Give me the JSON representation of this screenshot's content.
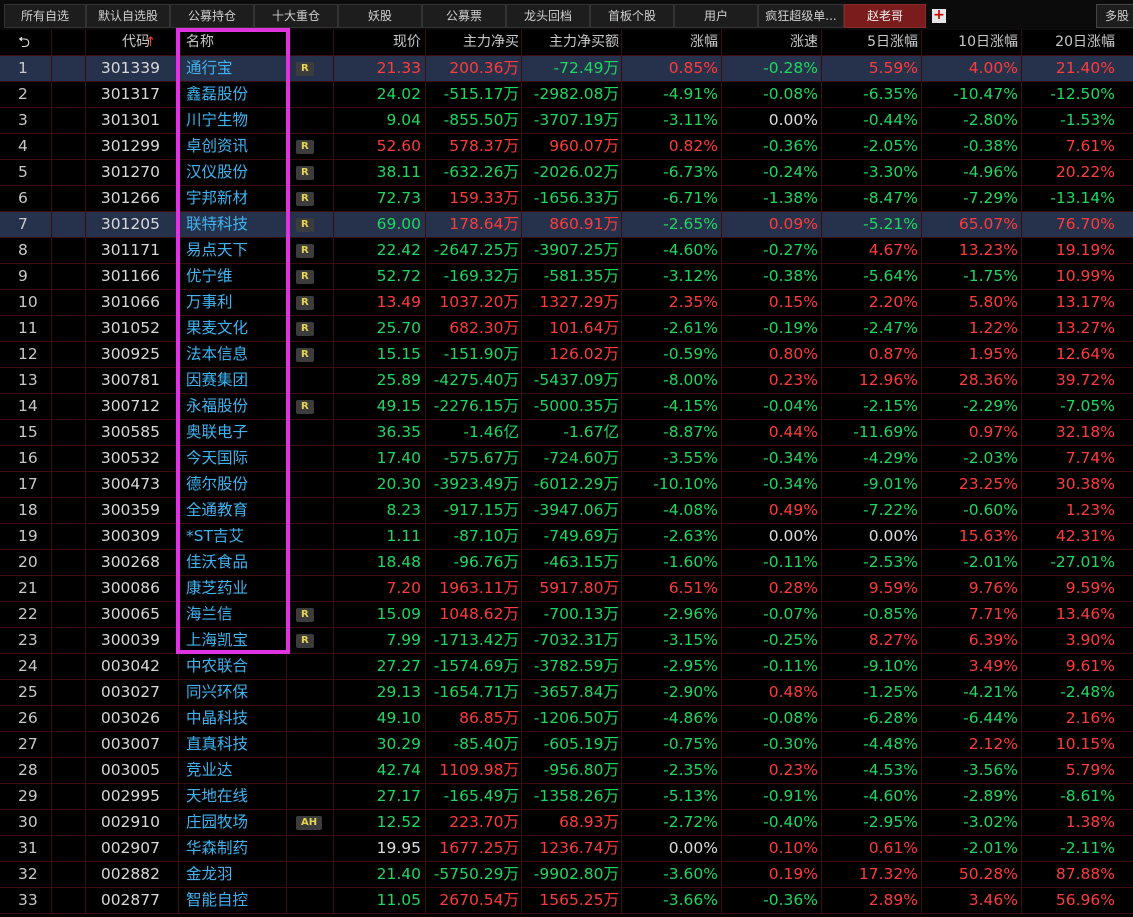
{
  "tabs": [
    {
      "label": "所有自选",
      "active": false
    },
    {
      "label": "默认自选股",
      "active": false
    },
    {
      "label": "公募持仓",
      "active": false
    },
    {
      "label": "十大重仓",
      "active": false
    },
    {
      "label": "妖股",
      "active": false
    },
    {
      "label": "公募票",
      "active": false
    },
    {
      "label": "龙头回档",
      "active": false
    },
    {
      "label": "首板个股",
      "active": false
    },
    {
      "label": "用户",
      "active": false
    },
    {
      "label": "疯狂超级单...",
      "active": false
    },
    {
      "label": "赵老哥",
      "active": true
    }
  ],
  "add_tab_label": "+",
  "more_tab_label": "多股",
  "columns": {
    "back": "⮌",
    "code": "代码",
    "sort_arrow": "↑",
    "name": "名称",
    "price": "现价",
    "main_net_buy": "主力净买",
    "main_net_amount": "主力净买额",
    "change": "涨幅",
    "speed": "涨速",
    "d5": "5日涨幅",
    "d10": "10日涨幅",
    "d20": "20日涨幅"
  },
  "rows": [
    {
      "idx": "1",
      "code": "301339",
      "name": "通行宝",
      "tag": "R",
      "price": "21.33",
      "net": "200.36万",
      "amt": "-72.49万",
      "chg": "0.85%",
      "spd": "-0.28%",
      "d5": "5.59%",
      "d10": "4.00%",
      "d20": "21.40%",
      "selected": true
    },
    {
      "idx": "2",
      "code": "301317",
      "name": "鑫磊股份",
      "tag": "",
      "price": "24.02",
      "net": "-515.17万",
      "amt": "-2982.08万",
      "chg": "-4.91%",
      "spd": "-0.08%",
      "d5": "-6.35%",
      "d10": "-10.47%",
      "d20": "-12.50%"
    },
    {
      "idx": "3",
      "code": "301301",
      "name": "川宁生物",
      "tag": "",
      "price": "9.04",
      "net": "-855.50万",
      "amt": "-3707.19万",
      "chg": "-3.11%",
      "spd": "0.00%",
      "d5": "-0.44%",
      "d10": "-2.80%",
      "d20": "-1.53%"
    },
    {
      "idx": "4",
      "code": "301299",
      "name": "卓创资讯",
      "tag": "R",
      "price": "52.60",
      "net": "578.37万",
      "amt": "960.07万",
      "chg": "0.82%",
      "spd": "-0.36%",
      "d5": "-2.05%",
      "d10": "-0.38%",
      "d20": "7.61%"
    },
    {
      "idx": "5",
      "code": "301270",
      "name": "汉仪股份",
      "tag": "R",
      "price": "38.11",
      "net": "-632.26万",
      "amt": "-2026.02万",
      "chg": "-6.73%",
      "spd": "-0.24%",
      "d5": "-3.30%",
      "d10": "-4.96%",
      "d20": "20.22%"
    },
    {
      "idx": "6",
      "code": "301266",
      "name": "宇邦新材",
      "tag": "R",
      "price": "72.73",
      "net": "159.33万",
      "amt": "-1656.33万",
      "chg": "-6.71%",
      "spd": "-1.38%",
      "d5": "-8.47%",
      "d10": "-7.29%",
      "d20": "-13.14%"
    },
    {
      "idx": "7",
      "code": "301205",
      "name": "联特科技",
      "tag": "R",
      "price": "69.00",
      "net": "178.64万",
      "amt": "860.91万",
      "chg": "-2.65%",
      "spd": "0.09%",
      "d5": "-5.21%",
      "d10": "65.07%",
      "d20": "76.70%",
      "selected": true
    },
    {
      "idx": "8",
      "code": "301171",
      "name": "易点天下",
      "tag": "R",
      "price": "22.42",
      "net": "-2647.25万",
      "amt": "-3907.25万",
      "chg": "-4.60%",
      "spd": "-0.27%",
      "d5": "4.67%",
      "d10": "13.23%",
      "d20": "19.19%"
    },
    {
      "idx": "9",
      "code": "301166",
      "name": "优宁维",
      "tag": "R",
      "price": "52.72",
      "net": "-169.32万",
      "amt": "-581.35万",
      "chg": "-3.12%",
      "spd": "-0.38%",
      "d5": "-5.64%",
      "d10": "-1.75%",
      "d20": "10.99%"
    },
    {
      "idx": "10",
      "code": "301066",
      "name": "万事利",
      "tag": "R",
      "price": "13.49",
      "net": "1037.20万",
      "amt": "1327.29万",
      "chg": "2.35%",
      "spd": "0.15%",
      "d5": "2.20%",
      "d10": "5.80%",
      "d20": "13.17%"
    },
    {
      "idx": "11",
      "code": "301052",
      "name": "果麦文化",
      "tag": "R",
      "price": "25.70",
      "net": "682.30万",
      "amt": "101.64万",
      "chg": "-2.61%",
      "spd": "-0.19%",
      "d5": "-2.47%",
      "d10": "1.22%",
      "d20": "13.27%"
    },
    {
      "idx": "12",
      "code": "300925",
      "name": "法本信息",
      "tag": "R",
      "price": "15.15",
      "net": "-151.90万",
      "amt": "126.02万",
      "chg": "-0.59%",
      "spd": "0.80%",
      "d5": "0.87%",
      "d10": "1.95%",
      "d20": "12.64%"
    },
    {
      "idx": "13",
      "code": "300781",
      "name": "因赛集团",
      "tag": "",
      "price": "25.89",
      "net": "-4275.40万",
      "amt": "-5437.09万",
      "chg": "-8.00%",
      "spd": "0.23%",
      "d5": "12.96%",
      "d10": "28.36%",
      "d20": "39.72%"
    },
    {
      "idx": "14",
      "code": "300712",
      "name": "永福股份",
      "tag": "R",
      "price": "49.15",
      "net": "-2276.15万",
      "amt": "-5000.35万",
      "chg": "-4.15%",
      "spd": "-0.04%",
      "d5": "-2.15%",
      "d10": "-2.29%",
      "d20": "-7.05%"
    },
    {
      "idx": "15",
      "code": "300585",
      "name": "奥联电子",
      "tag": "",
      "price": "36.35",
      "net": "-1.46亿",
      "amt": "-1.67亿",
      "chg": "-8.87%",
      "spd": "0.44%",
      "d5": "-11.69%",
      "d10": "0.97%",
      "d20": "32.18%"
    },
    {
      "idx": "16",
      "code": "300532",
      "name": "今天国际",
      "tag": "",
      "price": "17.40",
      "net": "-575.67万",
      "amt": "-724.60万",
      "chg": "-3.55%",
      "spd": "-0.34%",
      "d5": "-4.29%",
      "d10": "-2.03%",
      "d20": "7.74%"
    },
    {
      "idx": "17",
      "code": "300473",
      "name": "德尔股份",
      "tag": "",
      "price": "20.30",
      "net": "-3923.49万",
      "amt": "-6012.29万",
      "chg": "-10.10%",
      "spd": "-0.34%",
      "d5": "-9.01%",
      "d10": "23.25%",
      "d20": "30.38%"
    },
    {
      "idx": "18",
      "code": "300359",
      "name": "全通教育",
      "tag": "",
      "price": "8.23",
      "net": "-917.15万",
      "amt": "-3947.06万",
      "chg": "-4.08%",
      "spd": "0.49%",
      "d5": "-7.22%",
      "d10": "-0.60%",
      "d20": "1.23%"
    },
    {
      "idx": "19",
      "code": "300309",
      "name": "*ST吉艾",
      "tag": "",
      "price": "1.11",
      "net": "-87.10万",
      "amt": "-749.69万",
      "chg": "-2.63%",
      "spd": "0.00%",
      "d5": "0.00%",
      "d10": "15.63%",
      "d20": "42.31%"
    },
    {
      "idx": "20",
      "code": "300268",
      "name": "佳沃食品",
      "tag": "",
      "price": "18.48",
      "net": "-96.76万",
      "amt": "-463.15万",
      "chg": "-1.60%",
      "spd": "-0.11%",
      "d5": "-2.53%",
      "d10": "-2.01%",
      "d20": "-27.01%"
    },
    {
      "idx": "21",
      "code": "300086",
      "name": "康芝药业",
      "tag": "",
      "price": "7.20",
      "net": "1963.11万",
      "amt": "5917.80万",
      "chg": "6.51%",
      "spd": "0.28%",
      "d5": "9.59%",
      "d10": "9.76%",
      "d20": "9.59%"
    },
    {
      "idx": "22",
      "code": "300065",
      "name": "海兰信",
      "tag": "R",
      "price": "15.09",
      "net": "1048.62万",
      "amt": "-700.13万",
      "chg": "-2.96%",
      "spd": "-0.07%",
      "d5": "-0.85%",
      "d10": "7.71%",
      "d20": "13.46%"
    },
    {
      "idx": "23",
      "code": "300039",
      "name": "上海凯宝",
      "tag": "R",
      "price": "7.99",
      "net": "-1713.42万",
      "amt": "-7032.31万",
      "chg": "-3.15%",
      "spd": "-0.25%",
      "d5": "8.27%",
      "d10": "6.39%",
      "d20": "3.90%"
    },
    {
      "idx": "24",
      "code": "003042",
      "name": "中农联合",
      "tag": "",
      "price": "27.27",
      "net": "-1574.69万",
      "amt": "-3782.59万",
      "chg": "-2.95%",
      "spd": "-0.11%",
      "d5": "-9.10%",
      "d10": "3.49%",
      "d20": "9.61%"
    },
    {
      "idx": "25",
      "code": "003027",
      "name": "同兴环保",
      "tag": "",
      "price": "29.13",
      "net": "-1654.71万",
      "amt": "-3657.84万",
      "chg": "-2.90%",
      "spd": "0.48%",
      "d5": "-1.25%",
      "d10": "-4.21%",
      "d20": "-2.48%"
    },
    {
      "idx": "26",
      "code": "003026",
      "name": "中晶科技",
      "tag": "",
      "price": "49.10",
      "net": "86.85万",
      "amt": "-1206.50万",
      "chg": "-4.86%",
      "spd": "-0.08%",
      "d5": "-6.28%",
      "d10": "-6.44%",
      "d20": "2.16%"
    },
    {
      "idx": "27",
      "code": "003007",
      "name": "直真科技",
      "tag": "",
      "price": "30.29",
      "net": "-85.40万",
      "amt": "-605.19万",
      "chg": "-0.75%",
      "spd": "-0.30%",
      "d5": "-4.48%",
      "d10": "2.12%",
      "d20": "10.15%"
    },
    {
      "idx": "28",
      "code": "003005",
      "name": "竞业达",
      "tag": "",
      "price": "42.74",
      "net": "1109.98万",
      "amt": "-956.80万",
      "chg": "-2.35%",
      "spd": "0.23%",
      "d5": "-4.53%",
      "d10": "-3.56%",
      "d20": "5.79%"
    },
    {
      "idx": "29",
      "code": "002995",
      "name": "天地在线",
      "tag": "",
      "price": "27.17",
      "net": "-165.49万",
      "amt": "-1358.26万",
      "chg": "-5.13%",
      "spd": "-0.91%",
      "d5": "-4.60%",
      "d10": "-2.89%",
      "d20": "-8.61%"
    },
    {
      "idx": "30",
      "code": "002910",
      "name": "庄园牧场",
      "tag": "AH",
      "price": "12.52",
      "net": "223.70万",
      "amt": "68.93万",
      "chg": "-2.72%",
      "spd": "-0.40%",
      "d5": "-2.95%",
      "d10": "-3.02%",
      "d20": "1.38%"
    },
    {
      "idx": "31",
      "code": "002907",
      "name": "华森制药",
      "tag": "",
      "price": "19.95",
      "net": "1677.25万",
      "amt": "1236.74万",
      "chg": "0.00%",
      "spd": "0.10%",
      "d5": "0.61%",
      "d10": "-2.01%",
      "d20": "-2.11%"
    },
    {
      "idx": "32",
      "code": "002882",
      "name": "金龙羽",
      "tag": "",
      "price": "21.40",
      "net": "-5750.29万",
      "amt": "-9902.80万",
      "chg": "-3.60%",
      "spd": "0.19%",
      "d5": "17.32%",
      "d10": "50.28%",
      "d20": "87.88%"
    },
    {
      "idx": "33",
      "code": "002877",
      "name": "智能自控",
      "tag": "",
      "price": "11.05",
      "net": "2670.54万",
      "amt": "1565.25万",
      "chg": "-3.66%",
      "spd": "-0.36%",
      "d5": "2.89%",
      "d10": "3.46%",
      "d20": "56.96%"
    }
  ],
  "colors": {
    "up": "#ff3b3b",
    "down": "#1ed760",
    "flat": "#dcdcdc",
    "name": "#3fb3f0",
    "highlight_box": "#e032e0",
    "selected_row": "#26324b"
  }
}
